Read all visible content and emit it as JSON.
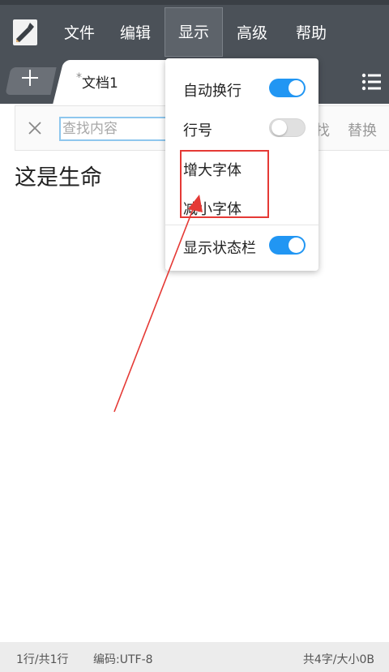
{
  "menubar": {
    "items": [
      "文件",
      "编辑",
      "显示",
      "高级",
      "帮助"
    ],
    "active": "显示"
  },
  "tabs": {
    "add_icon": "plus-icon",
    "current": {
      "modified_marker": "*",
      "label": "文档1"
    },
    "list_icon": "list-icon"
  },
  "search": {
    "placeholder": "查找内容",
    "find_label": "找",
    "replace_label": "替换"
  },
  "document": {
    "content": "这是生命"
  },
  "view_menu": {
    "word_wrap": {
      "label": "自动换行",
      "on": true
    },
    "line_numbers": {
      "label": "行号",
      "on": false
    },
    "increase_font": {
      "label": "增大字体"
    },
    "decrease_font": {
      "label": "减小字体"
    },
    "show_status_bar": {
      "label": "显示状态栏",
      "on": true
    }
  },
  "statusbar": {
    "lines": "1行/共1行",
    "encoding": "编码:UTF-8",
    "size": "共4字/大小0B"
  },
  "colors": {
    "toolbar": "#4b5158",
    "toggle_on": "#2196f3",
    "annotation": "#e53935"
  }
}
